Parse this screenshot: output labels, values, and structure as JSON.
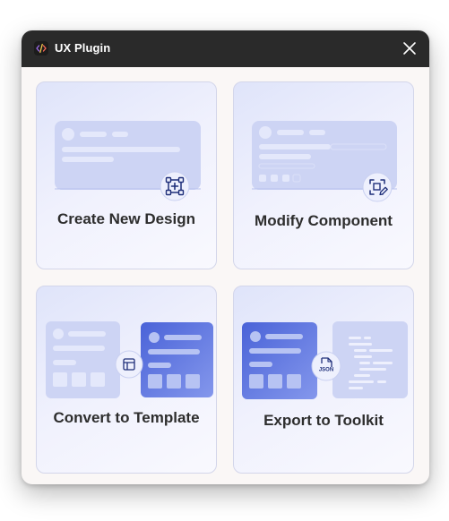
{
  "window": {
    "title": "UX Plugin",
    "app_icon": "code-slash-icon",
    "close_icon": "close-icon"
  },
  "cards": [
    {
      "label": "Create New Design",
      "icon": "add-frame-icon"
    },
    {
      "label": "Modify Component",
      "icon": "frame-edit-icon"
    },
    {
      "label": "Convert to Template",
      "icon": "layout-template-icon"
    },
    {
      "label": "Export to Toolkit",
      "icon": "json-file-icon",
      "icon_text": "JSON"
    }
  ],
  "colors": {
    "titlebar": "#2a2a2a",
    "window_bg": "#faf7f6",
    "card_gradient_start": "#dfe4fa",
    "card_border": "#d3d6ea",
    "mock_panel": "#cdd4f4",
    "mock_panel_accent": "#5b74de",
    "icon_stroke": "#1f2f7a",
    "label_text": "#2d2d2d"
  }
}
